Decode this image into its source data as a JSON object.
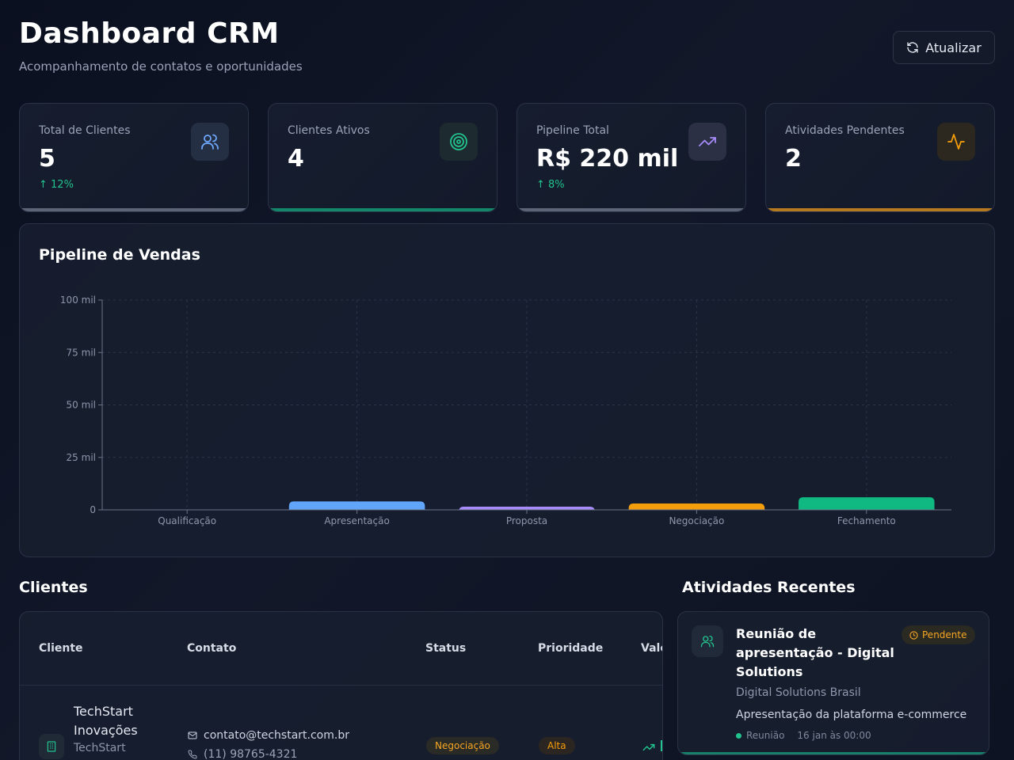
{
  "header": {
    "title": "Dashboard CRM",
    "subtitle": "Acompanhamento de contatos e oportunidades",
    "refresh_label": "Atualizar"
  },
  "stats": [
    {
      "label": "Total de Clientes",
      "value": "5",
      "trend": "↑ 12%",
      "icon": "users-icon",
      "accent": "#5b6577",
      "icon_color": "#6ea8fe"
    },
    {
      "label": "Clientes Ativos",
      "value": "4",
      "trend": "",
      "icon": "target-icon",
      "accent": "#13876a",
      "icon_color": "#22c38e"
    },
    {
      "label": "Pipeline Total",
      "value": "R$ 220 mil",
      "trend": "↑ 8%",
      "icon": "trending-up-icon",
      "accent": "#5b6577",
      "icon_color": "#a78bfa"
    },
    {
      "label": "Atividades Pendentes",
      "value": "2",
      "trend": "",
      "icon": "activity-icon",
      "accent": "#b7791f",
      "icon_color": "#f59e0b"
    }
  ],
  "pipeline": {
    "title": "Pipeline de Vendas"
  },
  "chart_data": {
    "type": "bar",
    "title": "Pipeline de Vendas",
    "categories": [
      "Qualificação",
      "Apresentação",
      "Proposta",
      "Negociação",
      "Fechamento"
    ],
    "values": [
      0,
      4000,
      1500,
      3000,
      6000
    ],
    "colors": [
      "#60a5fa",
      "#60a5fa",
      "#a78bfa",
      "#f59e0b",
      "#10b981"
    ],
    "yticks": [
      0,
      25000,
      50000,
      75000,
      100000
    ],
    "ytick_labels": [
      "0",
      "25 mil",
      "50 mil",
      "75 mil",
      "100 mil"
    ],
    "ylim": [
      0,
      100000
    ],
    "grid": true
  },
  "clients": {
    "title": "Clientes",
    "columns": [
      "Cliente",
      "Contato",
      "Status",
      "Prioridade",
      "Valo"
    ],
    "rows": [
      {
        "name": "TechStart Inovações",
        "company": "TechStart",
        "email": "contato@techstart.com.br",
        "phone": "(11) 98765-4321",
        "status": "Negociação",
        "priority": "Alta"
      }
    ]
  },
  "activities": {
    "title": "Atividades Recentes",
    "items": [
      {
        "title": "Reunião de apresentação - Digital Solutions",
        "status": "Pendente",
        "company": "Digital Solutions Brasil",
        "description": "Apresentação da plataforma e-commerce",
        "type": "Reunião",
        "date": "16 jan às 00:00"
      }
    ]
  }
}
